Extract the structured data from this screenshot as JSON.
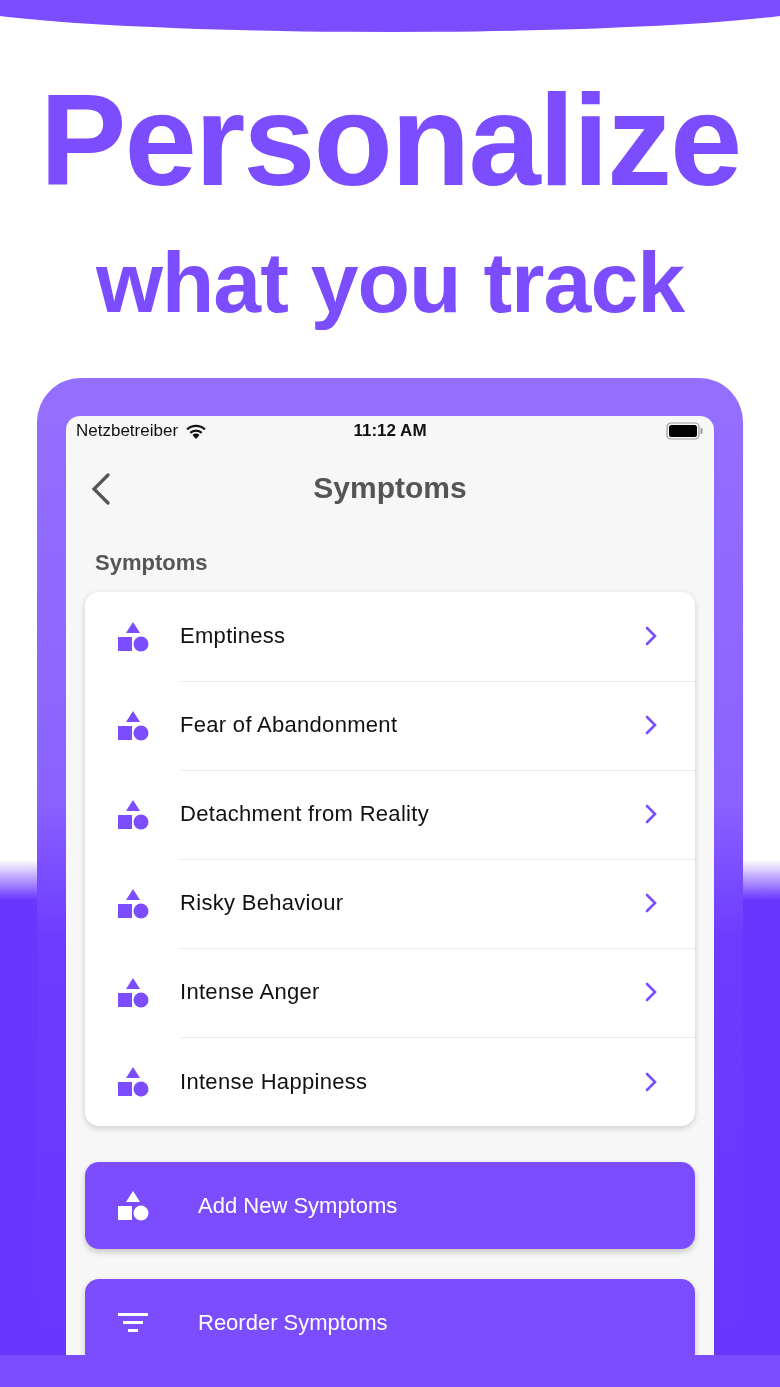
{
  "headline": {
    "title": "Personalize",
    "subtitle": "what you track"
  },
  "status_bar": {
    "carrier": "Netzbetreiber",
    "time": "11:12 AM"
  },
  "nav": {
    "title": "Symptoms"
  },
  "section_label": "Symptoms",
  "symptoms": [
    {
      "name": "Emptiness"
    },
    {
      "name": "Fear of Abandonment"
    },
    {
      "name": "Detachment from Reality"
    },
    {
      "name": "Risky Behaviour"
    },
    {
      "name": "Intense Anger"
    },
    {
      "name": "Intense Happiness"
    }
  ],
  "actions": [
    {
      "label": "Add New Symptoms",
      "kind": "add"
    },
    {
      "label": "Reorder Symptoms",
      "kind": "reorder"
    }
  ]
}
